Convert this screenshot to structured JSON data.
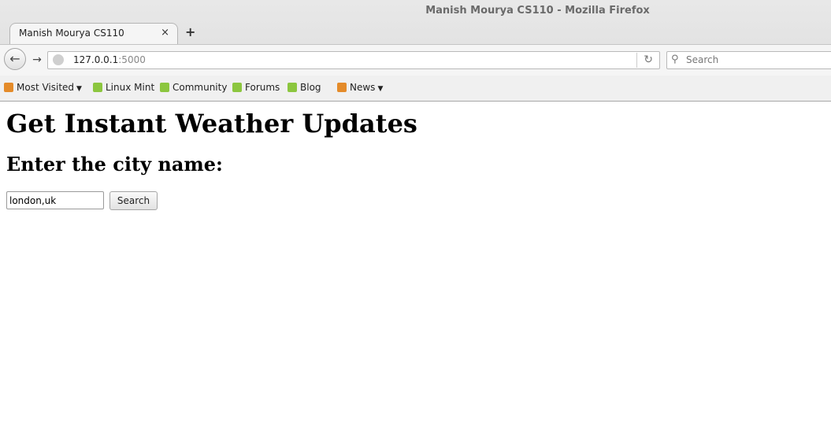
{
  "window": {
    "title": "Manish Mourya CS110 - Mozilla Firefox"
  },
  "tabs": [
    {
      "label": "Manish Mourya CS110",
      "close": "×"
    }
  ],
  "new_tab": "+",
  "nav": {
    "back": "←",
    "forward": "→",
    "url_host": "127.0.0.1",
    "url_port": ":5000",
    "reload": "↻",
    "search_placeholder": "Search",
    "search_icon": "magnifier-icon"
  },
  "bookmarks": [
    {
      "label": "Most Visited",
      "icon": "most-visited-icon",
      "dropdown": true
    },
    {
      "label": "Linux Mint",
      "icon": "mint-icon"
    },
    {
      "label": "Community",
      "icon": "mint-icon"
    },
    {
      "label": "Forums",
      "icon": "mint-icon"
    },
    {
      "label": "Blog",
      "icon": "mint-icon"
    },
    {
      "label": "News",
      "icon": "rss-icon",
      "dropdown": true
    }
  ],
  "page": {
    "heading": "Get Instant Weather Updates",
    "subheading": "Enter the city name:",
    "input_value": "london,uk",
    "button_label": "Search"
  },
  "colors": {
    "chrome_bg": "#e8e8e8",
    "mint_green": "#8cc63f",
    "rss_orange": "#e48b2a"
  }
}
